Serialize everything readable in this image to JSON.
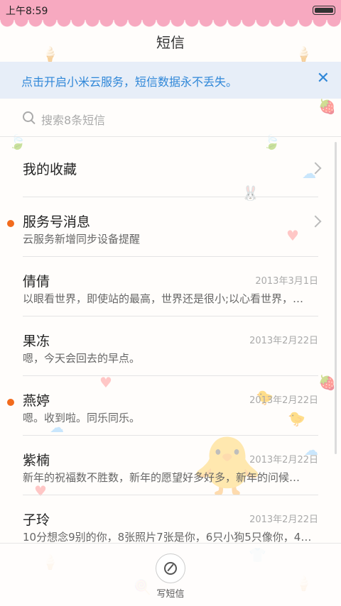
{
  "status": {
    "time": "上午8:59"
  },
  "header": {
    "title": "短信"
  },
  "banner": {
    "text": "点击开启小米云服务，短信数据永不丢失。",
    "close_label": "✕"
  },
  "search": {
    "placeholder": "搜索8条短信"
  },
  "favorites": {
    "label": "我的收藏"
  },
  "conversations": [
    {
      "name": "服务号消息",
      "preview": "云服务新增同步设备提醒",
      "date": "",
      "unread": true
    },
    {
      "name": "倩倩",
      "preview": "以眼看世界，即使站的最高，世界还是很小;以心看世界，…",
      "date": "2013年3月1日",
      "unread": false
    },
    {
      "name": "果冻",
      "preview": "嗯，今天会回去的早点。",
      "date": "2013年2月22日",
      "unread": false
    },
    {
      "name": "燕婷",
      "preview": "嗯。收到啦。同乐同乐。",
      "date": "2013年2月22日",
      "unread": true
    },
    {
      "name": "紫楠",
      "preview": "新年的祝福数不胜数，新年的愿望好多好多，新年的问候…",
      "date": "2013年2月22日",
      "unread": false
    },
    {
      "name": "子玲",
      "preview": "10分想念9别的你，8张照片7张是你，6只小狗5只像你，4…",
      "date": "2013年2月22日",
      "unread": false
    }
  ],
  "compose": {
    "label": "写短信"
  },
  "colors": {
    "accent": "#2f87d8",
    "status_bar": "#f7a9c0",
    "unread_dot": "#f26b1d"
  }
}
